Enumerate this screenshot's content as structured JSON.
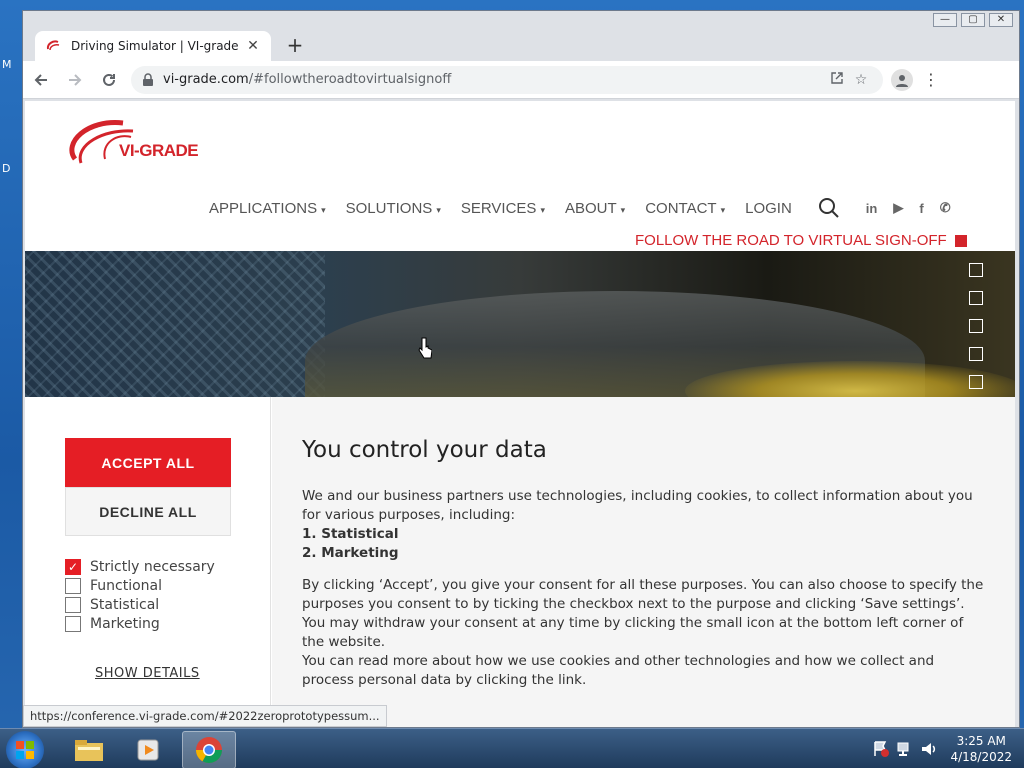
{
  "desktop": {
    "fragment_top": "M",
    "fragment_mid": "D"
  },
  "browser": {
    "window_controls": {
      "minimize": "—",
      "restore": "▢",
      "close": "✕"
    },
    "tab": {
      "title": "Driving Simulator | VI-grade",
      "close": "✕"
    },
    "new_tab": "+",
    "address": {
      "host": "vi-grade.com",
      "path": "/#followtheroadtovirtualsignoff"
    },
    "status_url": "https://conference.vi-grade.com/#2022zeroprototypessum..."
  },
  "site": {
    "logo_text": "VI-GRADE",
    "nav": [
      {
        "label": "APPLICATIONS",
        "caret": true
      },
      {
        "label": "SOLUTIONS",
        "caret": true
      },
      {
        "label": "SERVICES",
        "caret": true
      },
      {
        "label": "ABOUT",
        "caret": true
      },
      {
        "label": "CONTACT",
        "caret": true
      },
      {
        "label": "LOGIN",
        "caret": false
      }
    ],
    "caret_glyph": "▾",
    "social": {
      "linkedin": "in",
      "youtube": "▶",
      "facebook": "f",
      "wechat": "✆"
    },
    "follow_banner": "FOLLOW THE ROAD TO VIRTUAL SIGN-OFF",
    "hero_slides": 5,
    "accent": "#e51e25"
  },
  "consent": {
    "accept_label": "ACCEPT ALL",
    "decline_label": "DECLINE ALL",
    "options": [
      {
        "label": "Strictly necessary",
        "checked": true
      },
      {
        "label": "Functional",
        "checked": false
      },
      {
        "label": "Statistical",
        "checked": false
      },
      {
        "label": "Marketing",
        "checked": false
      }
    ],
    "show_details": "SHOW DETAILS",
    "title": "You control your data",
    "intro": "We and our business partners use technologies, including cookies, to collect information about you for various purposes, including:",
    "purpose_1": "1. Statistical",
    "purpose_2": "2. Marketing",
    "para_1": "By clicking ‘Accept’, you give your consent for all these purposes. You can also choose to specify the purposes you consent to by ticking the checkbox next to the purpose and clicking ‘Save settings’.",
    "para_2": "You may withdraw your consent at any time by clicking the small icon at the bottom left corner of the website.",
    "para_3": "You can read more about how we use cookies and other technologies and how we collect and process personal data by clicking the link."
  },
  "taskbar": {
    "time": "3:25 AM",
    "date": "4/18/2022"
  }
}
